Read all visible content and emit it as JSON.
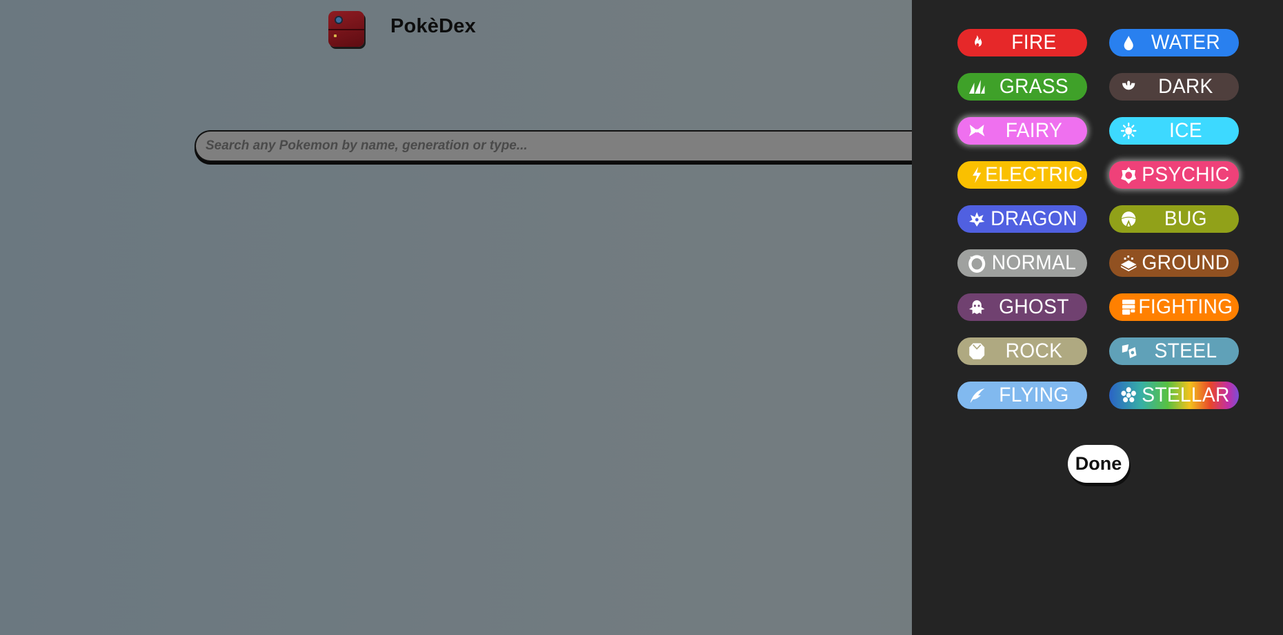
{
  "app": {
    "title": "PokèDex",
    "logo_icon": "pokedex-icon"
  },
  "search": {
    "placeholder": "Search any Pokemon by name, generation or type..."
  },
  "type_filter": {
    "types": [
      {
        "label": "FIRE",
        "color": "#e62829",
        "icon": "flame-icon",
        "selected": false
      },
      {
        "label": "WATER",
        "color": "#2980ef",
        "icon": "water-drop-icon",
        "selected": false
      },
      {
        "label": "GRASS",
        "color": "#3fa129",
        "icon": "leaf-icon",
        "selected": false
      },
      {
        "label": "DARK",
        "color": "#4f3f3d",
        "icon": "dark-moon-icon",
        "selected": false
      },
      {
        "label": "FAIRY",
        "color": "#ef70ef",
        "icon": "fairy-bow-icon",
        "selected": true
      },
      {
        "label": "ICE",
        "color": "#3dd9ff",
        "icon": "snowflake-icon",
        "selected": false
      },
      {
        "label": "ELECTRIC",
        "color": "#fac000",
        "icon": "lightning-icon",
        "selected": false
      },
      {
        "label": "PSYCHIC",
        "color": "#ef4179",
        "icon": "psychic-eye-icon",
        "selected": true
      },
      {
        "label": "DRAGON",
        "color": "#5060e1",
        "icon": "dragon-icon",
        "selected": false
      },
      {
        "label": "BUG",
        "color": "#91a119",
        "icon": "bug-icon",
        "selected": false
      },
      {
        "label": "NORMAL",
        "color": "#9fa19f",
        "icon": "normal-ring-icon",
        "selected": false
      },
      {
        "label": "GROUND",
        "color": "#915121",
        "icon": "ground-layers-icon",
        "selected": false
      },
      {
        "label": "GHOST",
        "color": "#704170",
        "icon": "ghost-icon",
        "selected": false
      },
      {
        "label": "FIGHTING",
        "color": "#ff8000",
        "icon": "fist-icon",
        "selected": false
      },
      {
        "label": "ROCK",
        "color": "#afa981",
        "icon": "rock-icon",
        "selected": false
      },
      {
        "label": "STEEL",
        "color": "#60a1b8",
        "icon": "steel-icon",
        "selected": false
      },
      {
        "label": "FLYING",
        "color": "#81b9ef",
        "icon": "wing-icon",
        "selected": false
      },
      {
        "label": "STELLAR",
        "color": "rainbow",
        "icon": "stellar-star-icon",
        "selected": false
      }
    ],
    "done_label": "Done"
  }
}
